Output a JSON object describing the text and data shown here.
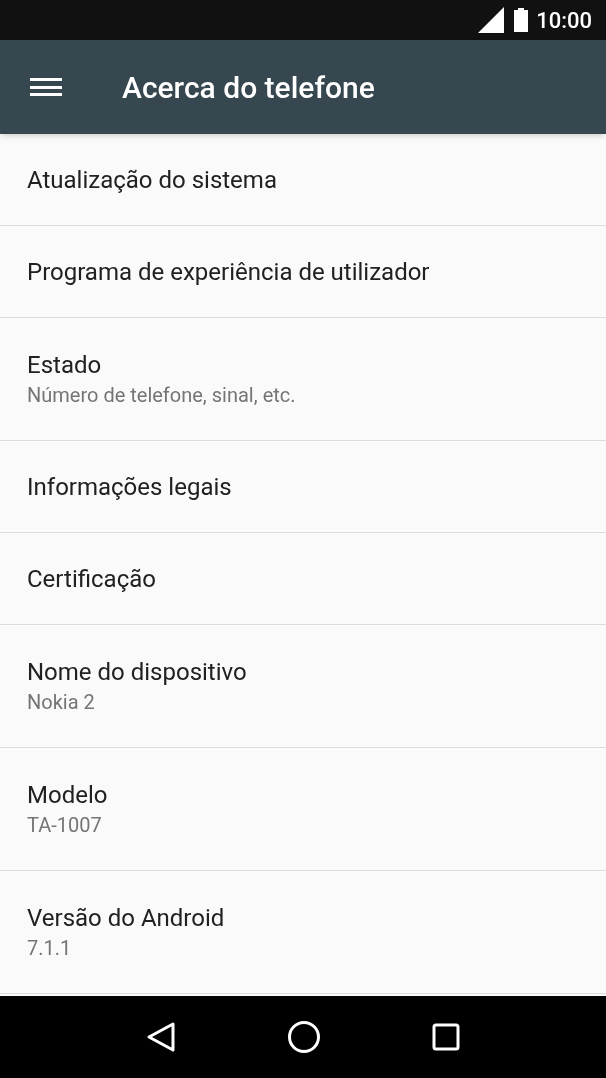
{
  "status_bar": {
    "time": "10:00"
  },
  "toolbar": {
    "title": "Acerca do telefone"
  },
  "items": [
    {
      "title": "Atualização do sistema"
    },
    {
      "title": "Programa de experiência de utilizador"
    },
    {
      "title": "Estado",
      "summary": "Número de telefone, sinal, etc."
    },
    {
      "title": "Informações legais"
    },
    {
      "title": "Certificação"
    },
    {
      "title": "Nome do dispositivo",
      "summary": "Nokia 2"
    },
    {
      "title": "Modelo",
      "summary": "TA-1007"
    },
    {
      "title": "Versão do Android",
      "summary": "7.1.1"
    }
  ]
}
